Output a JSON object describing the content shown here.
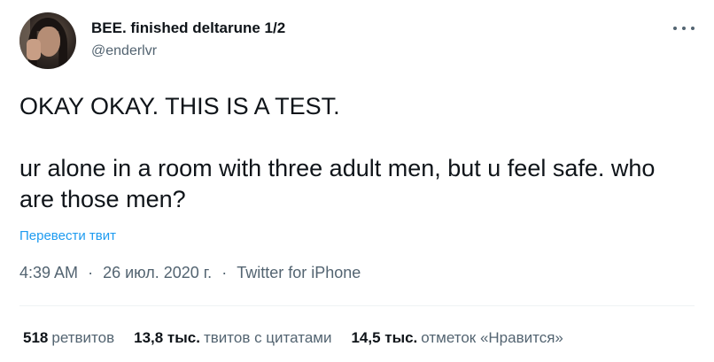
{
  "author": {
    "display_name": "BEE. finished deltarune 1/2",
    "handle": "@enderlvr"
  },
  "tweet": {
    "line1": "OKAY OKAY. THIS IS A TEST.",
    "line2": "ur alone in a room with three adult men, but u feel safe. who are those men?"
  },
  "translate_label": "Перевести твит",
  "meta": {
    "time": "4:39 AM",
    "date": "26 июл. 2020 г.",
    "source": "Twitter for iPhone",
    "separator": "·"
  },
  "stats": {
    "retweets_count": "518",
    "retweets_label": "ретвитов",
    "quotes_count": "13,8 тыс.",
    "quotes_label": "твитов с цитатами",
    "likes_count": "14,5 тыс.",
    "likes_label": "отметок «Нравится»"
  },
  "icons": {
    "more": "more-horizontal-icon",
    "avatar": "profile-photo"
  },
  "colors": {
    "text_primary": "#0f1419",
    "text_secondary": "#536471",
    "link": "#1d9bf0",
    "divider": "#eff3f4"
  }
}
